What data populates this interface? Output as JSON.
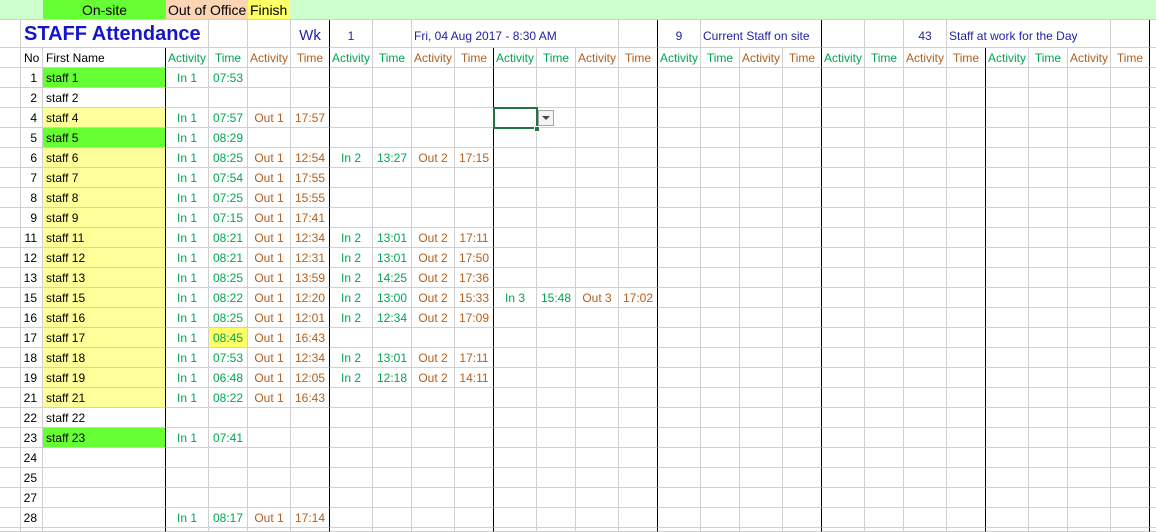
{
  "legend": {
    "onsite": "On-site",
    "out_of_office": "Out of Office",
    "finish": "Finish"
  },
  "title": "STAFF Attendance",
  "week_label": "Wk",
  "week": "1",
  "datetime": "Fri, 04 Aug 2017 - 8:30 AM",
  "current_staff_count": "9",
  "current_staff_label": "Current Staff on site",
  "day_staff_count": "43",
  "day_staff_label": "Staff at work for the Day",
  "headers": {
    "no": "No",
    "first_name": "First Name",
    "activity": "Activity",
    "time": "Time"
  },
  "colors": {
    "header_band": "#ccffcc",
    "onsite": "#66ff33",
    "out_of_office": "#fcd5b4",
    "finish": "#ffff66",
    "in_text": "#00a651",
    "out_text": "#b4601e",
    "title_text": "#1616c8",
    "info_text": "#2222aa",
    "selection": "#217346"
  },
  "rows": [
    {
      "no": "1",
      "name": "staff 1",
      "fill": "#66ff33",
      "entries": [
        {
          "activity": "In 1",
          "time": "07:53"
        }
      ]
    },
    {
      "no": "2",
      "name": "staff 2",
      "entries": []
    },
    {
      "no": "4",
      "name": "staff 4",
      "fill": "#ffff99",
      "entries": [
        {
          "activity": "In 1",
          "time": "07:57"
        },
        {
          "activity": "Out 1",
          "time": "17:57"
        }
      ]
    },
    {
      "no": "5",
      "name": "staff 5",
      "fill": "#66ff33",
      "entries": [
        {
          "activity": "In 1",
          "time": "08:29"
        }
      ]
    },
    {
      "no": "6",
      "name": "staff 6",
      "fill": "#ffff99",
      "entries": [
        {
          "activity": "In 1",
          "time": "08:25"
        },
        {
          "activity": "Out 1",
          "time": "12:54"
        },
        {
          "activity": "In 2",
          "time": "13:27"
        },
        {
          "activity": "Out 2",
          "time": "17:15"
        }
      ]
    },
    {
      "no": "7",
      "name": "staff 7",
      "fill": "#ffff99",
      "entries": [
        {
          "activity": "In 1",
          "time": "07:54"
        },
        {
          "activity": "Out 1",
          "time": "17:55"
        }
      ]
    },
    {
      "no": "8",
      "name": "staff 8",
      "fill": "#ffff99",
      "entries": [
        {
          "activity": "In 1",
          "time": "07:25"
        },
        {
          "activity": "Out 1",
          "time": "15:55"
        }
      ]
    },
    {
      "no": "9",
      "name": "staff 9",
      "fill": "#ffff99",
      "entries": [
        {
          "activity": "In 1",
          "time": "07:15"
        },
        {
          "activity": "Out 1",
          "time": "17:41"
        }
      ]
    },
    {
      "no": "11",
      "name": "staff 11",
      "fill": "#ffff99",
      "entries": [
        {
          "activity": "In 1",
          "time": "08:21"
        },
        {
          "activity": "Out 1",
          "time": "12:34"
        },
        {
          "activity": "In 2",
          "time": "13:01"
        },
        {
          "activity": "Out 2",
          "time": "17:11"
        }
      ]
    },
    {
      "no": "12",
      "name": "staff 12",
      "fill": "#ffff99",
      "entries": [
        {
          "activity": "In 1",
          "time": "08:21"
        },
        {
          "activity": "Out 1",
          "time": "12:31"
        },
        {
          "activity": "In 2",
          "time": "13:01"
        },
        {
          "activity": "Out 2",
          "time": "17:50"
        }
      ]
    },
    {
      "no": "13",
      "name": "staff 13",
      "fill": "#ffff99",
      "entries": [
        {
          "activity": "In 1",
          "time": "08:25"
        },
        {
          "activity": "Out 1",
          "time": "13:59"
        },
        {
          "activity": "In 2",
          "time": "14:25"
        },
        {
          "activity": "Out 2",
          "time": "17:36"
        }
      ]
    },
    {
      "no": "15",
      "name": "staff 15",
      "fill": "#ffff99",
      "entries": [
        {
          "activity": "In 1",
          "time": "08:22"
        },
        {
          "activity": "Out 1",
          "time": "12:20"
        },
        {
          "activity": "In 2",
          "time": "13:00"
        },
        {
          "activity": "Out 2",
          "time": "15:33"
        },
        {
          "activity": "In 3",
          "time": "15:48"
        },
        {
          "activity": "Out 3",
          "time": "17:02"
        }
      ]
    },
    {
      "no": "16",
      "name": "staff 16",
      "fill": "#ffff99",
      "entries": [
        {
          "activity": "In 1",
          "time": "08:25"
        },
        {
          "activity": "Out 1",
          "time": "12:01"
        },
        {
          "activity": "In 2",
          "time": "12:34"
        },
        {
          "activity": "Out 2",
          "time": "17:09"
        }
      ]
    },
    {
      "no": "17",
      "name": "staff 17",
      "fill": "#ffff99",
      "entries": [
        {
          "activity": "In 1",
          "time": "08:45",
          "fill": "#ffff66"
        },
        {
          "activity": "Out 1",
          "time": "16:43"
        }
      ]
    },
    {
      "no": "18",
      "name": "staff 18",
      "fill": "#ffff99",
      "entries": [
        {
          "activity": "In 1",
          "time": "07:53"
        },
        {
          "activity": "Out 1",
          "time": "12:34"
        },
        {
          "activity": "In 2",
          "time": "13:01"
        },
        {
          "activity": "Out 2",
          "time": "17:11"
        }
      ]
    },
    {
      "no": "19",
      "name": "staff 19",
      "fill": "#ffff99",
      "entries": [
        {
          "activity": "In 1",
          "time": "06:48"
        },
        {
          "activity": "Out 1",
          "time": "12:05"
        },
        {
          "activity": "In 2",
          "time": "12:18"
        },
        {
          "activity": "Out 2",
          "time": "14:11"
        }
      ]
    },
    {
      "no": "21",
      "name": "staff 21",
      "fill": "#ffff99",
      "entries": [
        {
          "activity": "In 1",
          "time": "08:22"
        },
        {
          "activity": "Out 1",
          "time": "16:43"
        }
      ]
    },
    {
      "no": "22",
      "name": "staff 22",
      "entries": []
    },
    {
      "no": "23",
      "name": "staff 23",
      "fill": "#66ff33",
      "entries": [
        {
          "activity": "In 1",
          "time": "07:41"
        }
      ]
    },
    {
      "no": "24",
      "entries": []
    },
    {
      "no": "25",
      "entries": []
    },
    {
      "no": "27",
      "entries": []
    },
    {
      "no": "28",
      "entries": [
        {
          "activity": "In 1",
          "time": "08:17"
        },
        {
          "activity": "Out 1",
          "time": "17:14"
        }
      ]
    }
  ]
}
